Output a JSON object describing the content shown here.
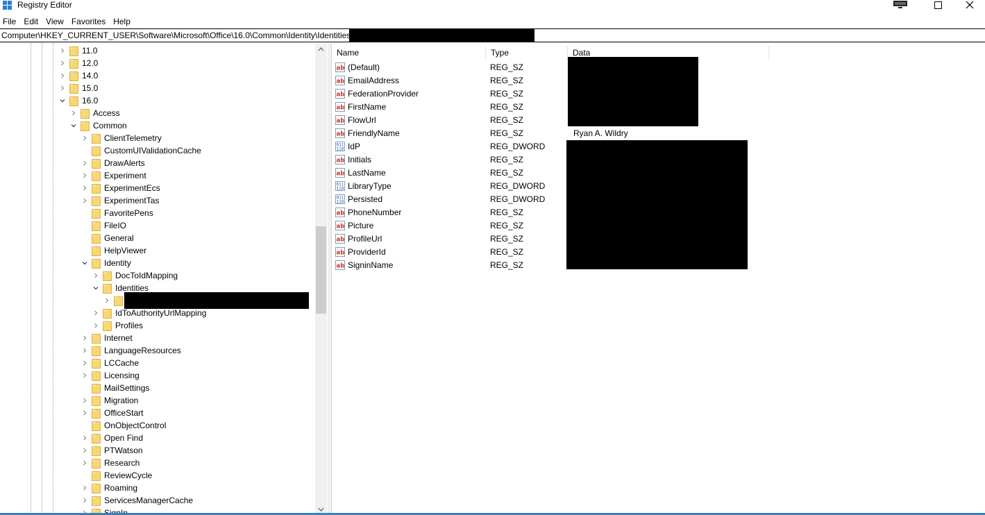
{
  "window": {
    "title": "Registry Editor",
    "minimize_label": "—",
    "maximize_label": "☐",
    "close_label": "✕"
  },
  "menu": [
    "File",
    "Edit",
    "View",
    "Favorites",
    "Help"
  ],
  "address": "Computer\\HKEY_CURRENT_USER\\Software\\Microsoft\\Office\\16.0\\Common\\Identity\\Identities",
  "tree": [
    {
      "label": "11.0",
      "depth": 0,
      "expanded": false,
      "has_children": true
    },
    {
      "label": "12.0",
      "depth": 0,
      "expanded": false,
      "has_children": true
    },
    {
      "label": "14.0",
      "depth": 0,
      "expanded": false,
      "has_children": true
    },
    {
      "label": "15.0",
      "depth": 0,
      "expanded": false,
      "has_children": true
    },
    {
      "label": "16.0",
      "depth": 0,
      "expanded": true,
      "has_children": true
    },
    {
      "label": "Access",
      "depth": 1,
      "expanded": false,
      "has_children": true
    },
    {
      "label": "Common",
      "depth": 1,
      "expanded": true,
      "has_children": true
    },
    {
      "label": "ClientTelemetry",
      "depth": 2,
      "expanded": false,
      "has_children": true
    },
    {
      "label": "CustomUIValidationCache",
      "depth": 2,
      "expanded": false,
      "has_children": false
    },
    {
      "label": "DrawAlerts",
      "depth": 2,
      "expanded": false,
      "has_children": true
    },
    {
      "label": "Experiment",
      "depth": 2,
      "expanded": false,
      "has_children": true
    },
    {
      "label": "ExperimentEcs",
      "depth": 2,
      "expanded": false,
      "has_children": true
    },
    {
      "label": "ExperimentTas",
      "depth": 2,
      "expanded": false,
      "has_children": true
    },
    {
      "label": "FavoritePens",
      "depth": 2,
      "expanded": false,
      "has_children": false
    },
    {
      "label": "FileIO",
      "depth": 2,
      "expanded": false,
      "has_children": false
    },
    {
      "label": "General",
      "depth": 2,
      "expanded": false,
      "has_children": false
    },
    {
      "label": "HelpViewer",
      "depth": 2,
      "expanded": false,
      "has_children": false
    },
    {
      "label": "Identity",
      "depth": 2,
      "expanded": true,
      "has_children": true
    },
    {
      "label": "DocToIdMapping",
      "depth": 3,
      "expanded": false,
      "has_children": true
    },
    {
      "label": "Identities",
      "depth": 3,
      "expanded": true,
      "has_children": true
    },
    {
      "label": "",
      "depth": 4,
      "expanded": false,
      "has_children": true,
      "redacted": true
    },
    {
      "label": "IdToAuthorityUrlMapping",
      "depth": 3,
      "expanded": false,
      "has_children": true
    },
    {
      "label": "Profiles",
      "depth": 3,
      "expanded": false,
      "has_children": true
    },
    {
      "label": "Internet",
      "depth": 2,
      "expanded": false,
      "has_children": true
    },
    {
      "label": "LanguageResources",
      "depth": 2,
      "expanded": false,
      "has_children": true
    },
    {
      "label": "LCCache",
      "depth": 2,
      "expanded": false,
      "has_children": true
    },
    {
      "label": "Licensing",
      "depth": 2,
      "expanded": false,
      "has_children": true
    },
    {
      "label": "MailSettings",
      "depth": 2,
      "expanded": false,
      "has_children": false
    },
    {
      "label": "Migration",
      "depth": 2,
      "expanded": false,
      "has_children": true
    },
    {
      "label": "OfficeStart",
      "depth": 2,
      "expanded": false,
      "has_children": true
    },
    {
      "label": "OnObjectControl",
      "depth": 2,
      "expanded": false,
      "has_children": false
    },
    {
      "label": "Open Find",
      "depth": 2,
      "expanded": false,
      "has_children": true
    },
    {
      "label": "PTWatson",
      "depth": 2,
      "expanded": false,
      "has_children": true
    },
    {
      "label": "Research",
      "depth": 2,
      "expanded": false,
      "has_children": true
    },
    {
      "label": "ReviewCycle",
      "depth": 2,
      "expanded": false,
      "has_children": false
    },
    {
      "label": "Roaming",
      "depth": 2,
      "expanded": false,
      "has_children": true
    },
    {
      "label": "ServicesManagerCache",
      "depth": 2,
      "expanded": false,
      "has_children": true
    },
    {
      "label": "SignIn",
      "depth": 2,
      "expanded": false,
      "has_children": true
    }
  ],
  "columns": {
    "name": "Name",
    "type": "Type",
    "data": "Data"
  },
  "values": [
    {
      "name": "(Default)",
      "type": "REG_SZ",
      "data": "",
      "kind": "string"
    },
    {
      "name": "EmailAddress",
      "type": "REG_SZ",
      "data": "",
      "kind": "string"
    },
    {
      "name": "FederationProvider",
      "type": "REG_SZ",
      "data": "",
      "kind": "string"
    },
    {
      "name": "FirstName",
      "type": "REG_SZ",
      "data": "",
      "kind": "string"
    },
    {
      "name": "FlowUrl",
      "type": "REG_SZ",
      "data": "",
      "kind": "string"
    },
    {
      "name": "FriendlyName",
      "type": "REG_SZ",
      "data": "Ryan A. Wildry",
      "kind": "string"
    },
    {
      "name": "IdP",
      "type": "REG_DWORD",
      "data": "",
      "kind": "binary"
    },
    {
      "name": "Initials",
      "type": "REG_SZ",
      "data": "",
      "kind": "string"
    },
    {
      "name": "LastName",
      "type": "REG_SZ",
      "data": "",
      "kind": "string"
    },
    {
      "name": "LibraryType",
      "type": "REG_DWORD",
      "data": "",
      "kind": "binary"
    },
    {
      "name": "Persisted",
      "type": "REG_DWORD",
      "data": "",
      "kind": "binary"
    },
    {
      "name": "PhoneNumber",
      "type": "REG_SZ",
      "data": "",
      "kind": "string"
    },
    {
      "name": "Picture",
      "type": "REG_SZ",
      "data": "",
      "kind": "string"
    },
    {
      "name": "ProfileUrl",
      "type": "REG_SZ",
      "data": "",
      "kind": "string"
    },
    {
      "name": "ProviderId",
      "type": "REG_SZ",
      "data": "",
      "kind": "string"
    },
    {
      "name": "SigninName",
      "type": "REG_SZ",
      "data": "",
      "kind": "string"
    }
  ],
  "colors": {
    "folder": "#f8d775",
    "folder_edge": "#dcb046",
    "string_icon": "#c0392b",
    "binary_icon": "#1f5fa8",
    "accent": "#3c7fb1"
  }
}
